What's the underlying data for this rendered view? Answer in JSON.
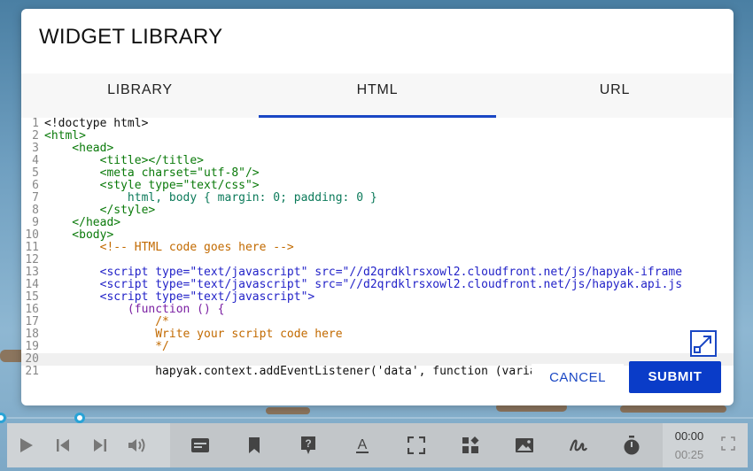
{
  "modal": {
    "title": "WIDGET LIBRARY",
    "tabs": [
      {
        "label": "LIBRARY",
        "active": false
      },
      {
        "label": "HTML",
        "active": true
      },
      {
        "label": "URL",
        "active": false
      }
    ],
    "cancel_label": "CANCEL",
    "submit_label": "SUBMIT",
    "expand_icon": "expand-icon"
  },
  "editor": {
    "line_numbers": [
      "1",
      "2",
      "3",
      "4",
      "5",
      "6",
      "7",
      "8",
      "9",
      "10",
      "11",
      "12",
      "13",
      "14",
      "15",
      "16",
      "17",
      "18",
      "19",
      "20",
      "21"
    ],
    "lines": [
      "<!doctype html>",
      "<html>",
      "    <head>",
      "        <title></title>",
      "        <meta charset=\"utf-8\"/>",
      "        <style type=\"text/css\">",
      "            html, body { margin: 0; padding: 0 }",
      "        </style>",
      "    </head>",
      "    <body>",
      "        <!-- HTML code goes here -->",
      "",
      "        <script type=\"text/javascript\" src=\"//d2qrdklrsxowl2.cloudfront.net/js/hapyak-iframe",
      "        <script type=\"text/javascript\" src=\"//d2qrdklrsxowl2.cloudfront.net/js/hapyak.api.js",
      "        <script type=\"text/javascript\">",
      "            (function () {",
      "                /*",
      "                Write your script code here",
      "                */",
      "",
      "                hapyak.context.addEventListener('data', function (variables) {"
    ]
  },
  "player": {
    "current_time": "00:00",
    "duration": "00:25",
    "controls": [
      "play-icon",
      "skip-back-icon",
      "skip-forward-icon",
      "volume-icon"
    ],
    "tools": [
      "caption-icon",
      "bookmark-icon",
      "question-icon",
      "text-icon",
      "frame-icon",
      "widget-icon",
      "image-icon",
      "draw-icon",
      "timer-icon"
    ]
  },
  "colors": {
    "accent": "#1a47c4",
    "submit": "#0a3cc8",
    "scrubber_knob": "#29a3d6"
  }
}
